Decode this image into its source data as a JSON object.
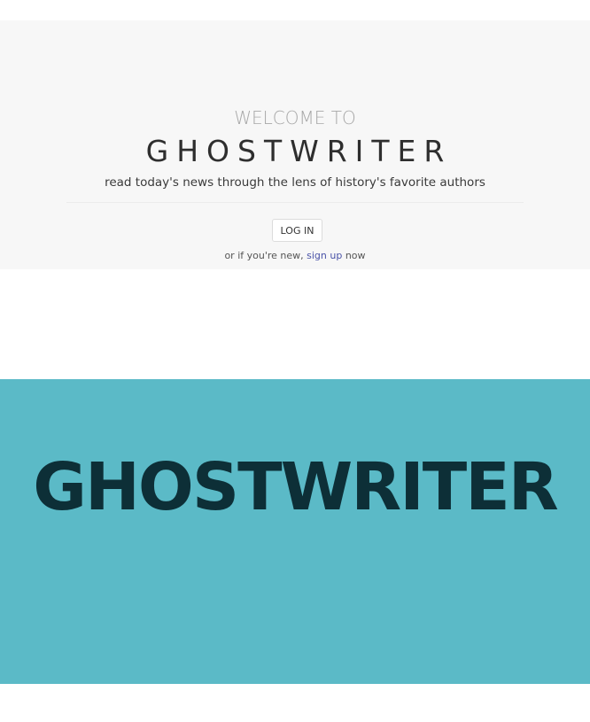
{
  "hero": {
    "welcome": "WELCOME TO",
    "title": "GHOSTWRITER",
    "tagline": "read today's news through the lens of history's favorite authors",
    "login_label": "LOG IN",
    "signup_prefix": "or if you're new, ",
    "signup_link": "sign up",
    "signup_suffix": " now"
  },
  "banner": {
    "logo_text": "GHOSTWRITER"
  },
  "colors": {
    "hero_bg": "#f7f7f7",
    "banner_bg": "#5bbac7",
    "banner_text": "#0d2f37",
    "link": "#4a53a8"
  }
}
